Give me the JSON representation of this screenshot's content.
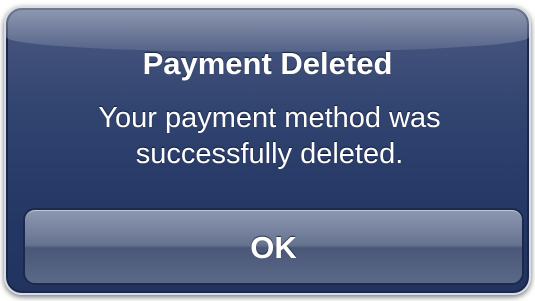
{
  "alert": {
    "title": "Payment Deleted",
    "message_line1": "Your payment method was",
    "message_line2": "successfully deleted.",
    "ok_label": "OK"
  },
  "colors": {
    "panel": "#2c3d69",
    "text": "#ffffff",
    "button": "#6b7893"
  }
}
